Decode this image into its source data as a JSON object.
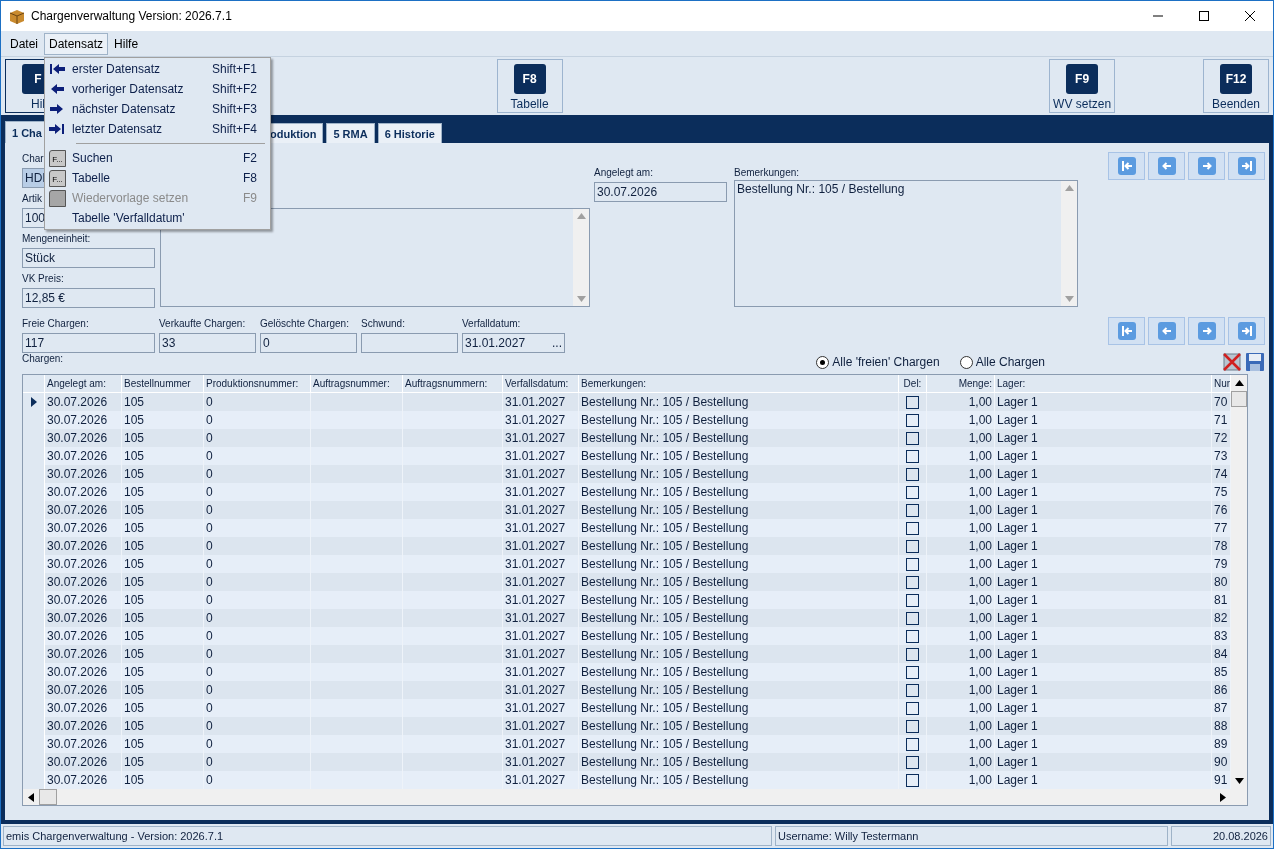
{
  "window": {
    "title": "Chargenverwaltung Version: 2026.7.1"
  },
  "menu_bar": [
    {
      "label": "Datei",
      "selected": false
    },
    {
      "label": "Datensatz",
      "selected": true
    },
    {
      "label": "Hilfe",
      "selected": false
    }
  ],
  "dropdown": [
    {
      "kind": "nav",
      "label": "erster Datensatz",
      "shortcut": "Shift+F1",
      "disabled": false
    },
    {
      "kind": "nav",
      "label": "vorheriger Datensatz",
      "shortcut": "Shift+F2",
      "disabled": false
    },
    {
      "kind": "nav",
      "label": "nächster Datensatz",
      "shortcut": "Shift+F3",
      "disabled": false
    },
    {
      "kind": "nav",
      "label": "letzter Datensatz",
      "shortcut": "Shift+F4",
      "disabled": false
    },
    {
      "kind": "separator"
    },
    {
      "kind": "function",
      "key_icon": "F...",
      "label": "Suchen",
      "shortcut": "F2",
      "disabled": false
    },
    {
      "kind": "function",
      "key_icon": "F...",
      "label": "Tabelle",
      "shortcut": "F8",
      "disabled": false
    },
    {
      "kind": "function",
      "label": "Wiedervorlage setzen",
      "shortcut": "F9",
      "disabled": true
    },
    {
      "kind": "plain",
      "label": "Tabelle 'Verfalldatum'",
      "disabled": false
    }
  ],
  "toolbar": [
    {
      "key": "F",
      "label": "Hil"
    },
    {
      "key": "F8",
      "label": "Tabelle"
    },
    {
      "key": "F9",
      "label": "WV setzen"
    },
    {
      "key": "F12",
      "label": "Beenden"
    }
  ],
  "tabs": [
    {
      "label": "1 Cha",
      "selected": true
    },
    {
      "label": "oduktion",
      "selected": false
    },
    {
      "label": "5 RMA",
      "selected": false
    },
    {
      "label": "6 Historie",
      "selected": false
    }
  ],
  "left_fields": [
    {
      "label": "Char",
      "value": "HDI",
      "selected": true
    },
    {
      "label": "Artik",
      "value": "100",
      "selected": false
    },
    {
      "label": "Mengeneinheit:",
      "value": "Stück",
      "selected": false
    },
    {
      "label": "VK Preis:",
      "value": "12,85 €",
      "selected": false
    }
  ],
  "created": {
    "label": "Angelegt am:",
    "value": "30.07.2026"
  },
  "remarks": {
    "label": "Bemerkungen:",
    "value": "Bestellung Nr.: 105 / Bestellung"
  },
  "counters": [
    {
      "label": "Freie Chargen:",
      "value": "117"
    },
    {
      "label": "Verkaufte Chargen:",
      "value": "33"
    },
    {
      "label": "Gelöschte Chargen:",
      "value": "0"
    },
    {
      "label": "Schwund:"
    },
    {
      "label": "Verfalldatum:",
      "value": "31.01.2027",
      "button": "..."
    }
  ],
  "grid_label": "Chargen:",
  "filter": [
    {
      "label": "Alle 'freien' Chargen",
      "selected": true
    },
    {
      "label": "Alle Chargen",
      "selected": false
    }
  ],
  "columns": [
    {
      "label": "Angelegt am:",
      "kind": "text"
    },
    {
      "label": "Bestellnummer",
      "kind": "text"
    },
    {
      "label": "Produktionsnummer:",
      "kind": "text"
    },
    {
      "label": "Auftragsnummer:",
      "kind": "text"
    },
    {
      "label": "Auftragsnummern:",
      "kind": "text"
    },
    {
      "label": "Verfallsdatum:",
      "kind": "text"
    },
    {
      "label": "Bemerkungen:",
      "kind": "text"
    },
    {
      "label": "Del:",
      "kind": "check"
    },
    {
      "label": "Menge:",
      "kind": "number"
    },
    {
      "label": "Lager:",
      "kind": "text"
    },
    {
      "label": "Nur",
      "kind": "text"
    }
  ],
  "rows": [
    {
      "cells": [
        "30.07.2026",
        "105",
        "0",
        null,
        null,
        "31.01.2027",
        "Bestellung Nr.: 105 / Bestellung",
        false,
        "1,00",
        "Lager 1",
        "70"
      ],
      "current": true
    },
    {
      "cells": [
        "30.07.2026",
        "105",
        "0",
        null,
        null,
        "31.01.2027",
        "Bestellung Nr.: 105 / Bestellung",
        false,
        "1,00",
        "Lager 1",
        "71"
      ],
      "current": false
    },
    {
      "cells": [
        "30.07.2026",
        "105",
        "0",
        null,
        null,
        "31.01.2027",
        "Bestellung Nr.: 105 / Bestellung",
        false,
        "1,00",
        "Lager 1",
        "72"
      ],
      "current": false
    },
    {
      "cells": [
        "30.07.2026",
        "105",
        "0",
        null,
        null,
        "31.01.2027",
        "Bestellung Nr.: 105 / Bestellung",
        false,
        "1,00",
        "Lager 1",
        "73"
      ],
      "current": false
    },
    {
      "cells": [
        "30.07.2026",
        "105",
        "0",
        null,
        null,
        "31.01.2027",
        "Bestellung Nr.: 105 / Bestellung",
        false,
        "1,00",
        "Lager 1",
        "74"
      ],
      "current": false
    },
    {
      "cells": [
        "30.07.2026",
        "105",
        "0",
        null,
        null,
        "31.01.2027",
        "Bestellung Nr.: 105 / Bestellung",
        false,
        "1,00",
        "Lager 1",
        "75"
      ],
      "current": false
    },
    {
      "cells": [
        "30.07.2026",
        "105",
        "0",
        null,
        null,
        "31.01.2027",
        "Bestellung Nr.: 105 / Bestellung",
        false,
        "1,00",
        "Lager 1",
        "76"
      ],
      "current": false
    },
    {
      "cells": [
        "30.07.2026",
        "105",
        "0",
        null,
        null,
        "31.01.2027",
        "Bestellung Nr.: 105 / Bestellung",
        false,
        "1,00",
        "Lager 1",
        "77"
      ],
      "current": false
    },
    {
      "cells": [
        "30.07.2026",
        "105",
        "0",
        null,
        null,
        "31.01.2027",
        "Bestellung Nr.: 105 / Bestellung",
        false,
        "1,00",
        "Lager 1",
        "78"
      ],
      "current": false
    },
    {
      "cells": [
        "30.07.2026",
        "105",
        "0",
        null,
        null,
        "31.01.2027",
        "Bestellung Nr.: 105 / Bestellung",
        false,
        "1,00",
        "Lager 1",
        "79"
      ],
      "current": false
    },
    {
      "cells": [
        "30.07.2026",
        "105",
        "0",
        null,
        null,
        "31.01.2027",
        "Bestellung Nr.: 105 / Bestellung",
        false,
        "1,00",
        "Lager 1",
        "80"
      ],
      "current": false
    },
    {
      "cells": [
        "30.07.2026",
        "105",
        "0",
        null,
        null,
        "31.01.2027",
        "Bestellung Nr.: 105 / Bestellung",
        false,
        "1,00",
        "Lager 1",
        "81"
      ],
      "current": false
    },
    {
      "cells": [
        "30.07.2026",
        "105",
        "0",
        null,
        null,
        "31.01.2027",
        "Bestellung Nr.: 105 / Bestellung",
        false,
        "1,00",
        "Lager 1",
        "82"
      ],
      "current": false
    },
    {
      "cells": [
        "30.07.2026",
        "105",
        "0",
        null,
        null,
        "31.01.2027",
        "Bestellung Nr.: 105 / Bestellung",
        false,
        "1,00",
        "Lager 1",
        "83"
      ],
      "current": false
    },
    {
      "cells": [
        "30.07.2026",
        "105",
        "0",
        null,
        null,
        "31.01.2027",
        "Bestellung Nr.: 105 / Bestellung",
        false,
        "1,00",
        "Lager 1",
        "84"
      ],
      "current": false
    },
    {
      "cells": [
        "30.07.2026",
        "105",
        "0",
        null,
        null,
        "31.01.2027",
        "Bestellung Nr.: 105 / Bestellung",
        false,
        "1,00",
        "Lager 1",
        "85"
      ],
      "current": false
    },
    {
      "cells": [
        "30.07.2026",
        "105",
        "0",
        null,
        null,
        "31.01.2027",
        "Bestellung Nr.: 105 / Bestellung",
        false,
        "1,00",
        "Lager 1",
        "86"
      ],
      "current": false
    },
    {
      "cells": [
        "30.07.2026",
        "105",
        "0",
        null,
        null,
        "31.01.2027",
        "Bestellung Nr.: 105 / Bestellung",
        false,
        "1,00",
        "Lager 1",
        "87"
      ],
      "current": false
    },
    {
      "cells": [
        "30.07.2026",
        "105",
        "0",
        null,
        null,
        "31.01.2027",
        "Bestellung Nr.: 105 / Bestellung",
        false,
        "1,00",
        "Lager 1",
        "88"
      ],
      "current": false
    },
    {
      "cells": [
        "30.07.2026",
        "105",
        "0",
        null,
        null,
        "31.01.2027",
        "Bestellung Nr.: 105 / Bestellung",
        false,
        "1,00",
        "Lager 1",
        "89"
      ],
      "current": false
    },
    {
      "cells": [
        "30.07.2026",
        "105",
        "0",
        null,
        null,
        "31.01.2027",
        "Bestellung Nr.: 105 / Bestellung",
        false,
        "1,00",
        "Lager 1",
        "90"
      ],
      "current": false
    },
    {
      "cells": [
        "30.07.2026",
        "105",
        "0",
        null,
        null,
        "31.01.2027",
        "Bestellung Nr.: 105 / Bestellung",
        false,
        "1,00",
        "Lager 1",
        "91"
      ],
      "current": false
    }
  ],
  "status_bar": [
    "emis Chargenverwaltung - Version: 2026.7.1",
    "Username: Willy Testermann",
    "20.08.2026"
  ]
}
